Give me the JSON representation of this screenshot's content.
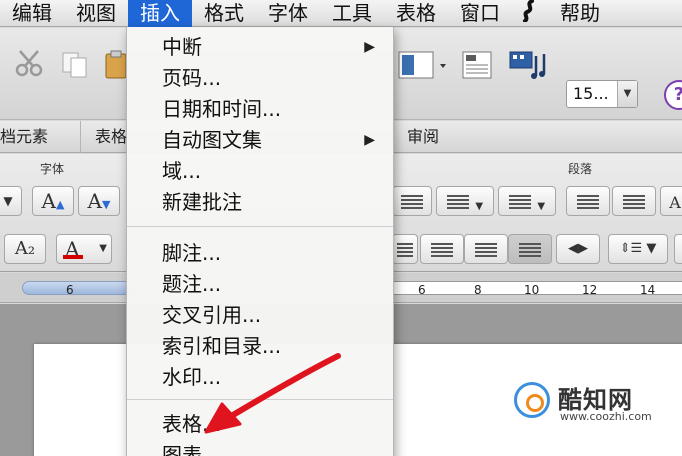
{
  "menubar": {
    "items": [
      "编辑",
      "视图",
      "插入",
      "格式",
      "字体",
      "工具",
      "表格",
      "窗口",
      "帮助"
    ],
    "active_index": 2,
    "logo_icon": "script-icon"
  },
  "toolbar": {
    "font_size": "15..."
  },
  "ribbon": {
    "tabs": [
      "档元素",
      "表格",
      "审阅"
    ],
    "group_font": "字体",
    "group_paragraph": "段落",
    "btn_grow_font": "A",
    "btn_shrink_font": "A",
    "btn_subscript": "A₂",
    "btn_font_color": "A"
  },
  "ruler": {
    "numbers": [
      "6",
      "6",
      "8",
      "10",
      "12",
      "14"
    ]
  },
  "insert_menu": {
    "items": [
      {
        "label": "中断",
        "submenu": true
      },
      {
        "label": "页码...",
        "submenu": false
      },
      {
        "label": "日期和时间...",
        "submenu": false
      },
      {
        "label": "自动图文集",
        "submenu": true
      },
      {
        "label": "域...",
        "submenu": false
      },
      {
        "label": "新建批注",
        "submenu": false
      },
      {
        "label": "脚注...",
        "submenu": false
      },
      {
        "label": "题注...",
        "submenu": false
      },
      {
        "label": "交叉引用...",
        "submenu": false
      },
      {
        "label": "索引和目录...",
        "submenu": false
      },
      {
        "label": "水印...",
        "submenu": false
      },
      {
        "label": "表格...",
        "submenu": false
      },
      {
        "label": "图表",
        "submenu": false
      }
    ],
    "submenu_glyph": "▶"
  },
  "watermark": {
    "name": "酷知网",
    "url": "www.coozhi.com"
  },
  "colors": {
    "menu_highlight": "#1f66d6",
    "annotation_arrow": "#e0141e"
  }
}
